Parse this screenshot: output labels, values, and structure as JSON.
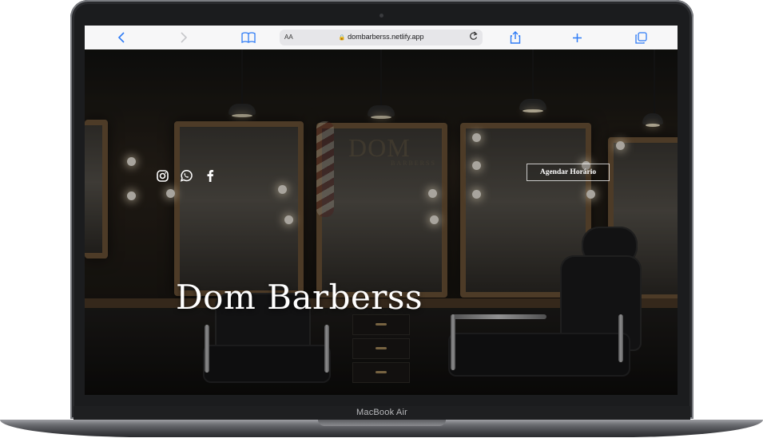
{
  "browser": {
    "url": "dombarberss.netlify.app",
    "text_size_label": "AA",
    "lock_icon": "lock-icon",
    "buttons": {
      "back": "chevron-left-icon",
      "forward": "chevron-right-icon",
      "bookmarks": "book-icon",
      "reload": "reload-icon",
      "share": "share-icon",
      "new_tab": "plus-icon",
      "tabs": "tabs-icon"
    },
    "accent_color": "#2f7cf6"
  },
  "page": {
    "title": "Dom Barberss",
    "watermark": "DOM",
    "watermark_sub": "BARBERSS",
    "cta_label": "Agendar Horário",
    "social": [
      "instagram-icon",
      "whatsapp-icon",
      "facebook-icon"
    ]
  },
  "device": {
    "label": "MacBook Air"
  }
}
